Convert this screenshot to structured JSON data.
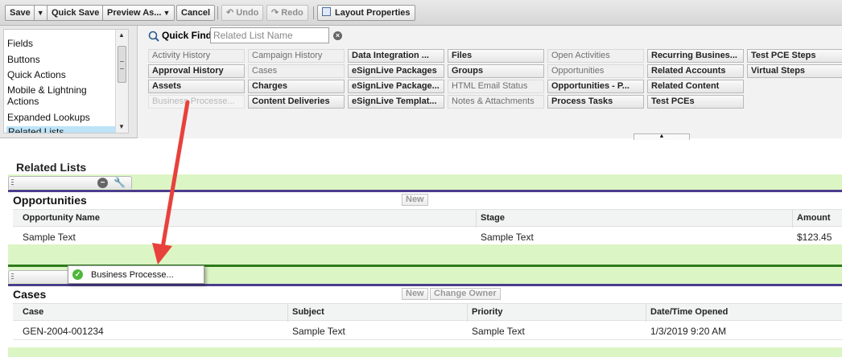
{
  "toolbar": {
    "save": "Save",
    "quick_save": "Quick Save",
    "preview_as": "Preview As...",
    "cancel": "Cancel",
    "undo": "Undo",
    "redo": "Redo",
    "layout_properties": "Layout Properties"
  },
  "categories": [
    "Fields",
    "Buttons",
    "Quick Actions",
    "Mobile & Lightning Actions",
    "Expanded Lookups",
    "Related Lists"
  ],
  "selected_category": "Related Lists",
  "quick_find": {
    "label": "Quick Find",
    "placeholder": "Related List Name"
  },
  "palette_items": [
    [
      "Activity History",
      "Approval History",
      "Assets",
      "Business Processe..."
    ],
    [
      "Campaign History",
      "Cases",
      "Charges",
      "Content Deliveries"
    ],
    [
      "Data Integration ...",
      "eSignLive Packages",
      "eSignLive Package...",
      "eSignLive Templat..."
    ],
    [
      "Files",
      "Groups",
      "HTML Email Status",
      "Notes & Attachments"
    ],
    [
      "Open Activities",
      "Opportunities",
      "Opportunities - P...",
      "Process Tasks"
    ],
    [
      "Recurring Busines...",
      "Related Accounts",
      "Related Content",
      "Test PCEs"
    ],
    [
      "Test PCE Steps",
      "Virtual Steps"
    ]
  ],
  "layout": {
    "section_title": "Related Lists",
    "opportunities": {
      "title": "Opportunities",
      "new_button": "New",
      "columns": [
        "Opportunity Name",
        "Stage",
        "Amount"
      ],
      "row": [
        "Sample Text",
        "Sample Text",
        "$123.45"
      ]
    },
    "drag_item": "Business Processe...",
    "cases": {
      "title": "Cases",
      "new_button": "New",
      "change_owner_button": "Change Owner",
      "columns": [
        "Case",
        "Subject",
        "Priority",
        "Date/Time Opened"
      ],
      "row": [
        "GEN-2004-001234",
        "Sample Text",
        "Sample Text",
        "1/3/2019 9:20 AM"
      ]
    }
  },
  "colors": {
    "drop_zone": "#dcf5c4",
    "list_border": "#4b3d8e",
    "drop_line": "#2f7a1d",
    "annotation_arrow": "#e8413c",
    "selected_category": "#bde3f9"
  }
}
